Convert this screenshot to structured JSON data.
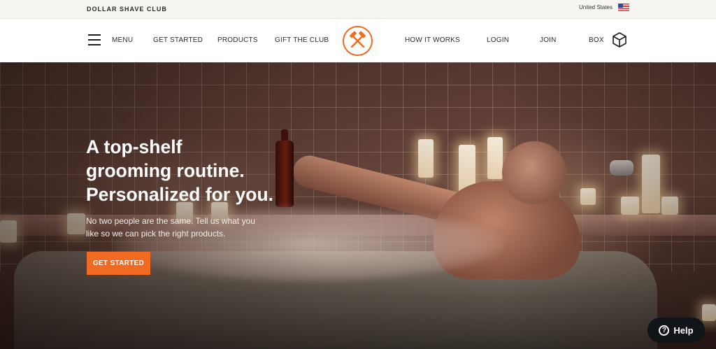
{
  "topbar": {
    "brand": "DOLLAR SHAVE CLUB",
    "region": "United States",
    "flag_icon": "us-flag-icon"
  },
  "nav": {
    "menu_label": "MENU",
    "menu_icon": "hamburger-icon",
    "left_items": [
      "GET STARTED",
      "PRODUCTS",
      "GIFT THE CLUB"
    ],
    "logo_icon": "crossed-hammers-logo",
    "right_items": [
      "HOW IT WORKS",
      "LOGIN",
      "JOIN",
      "BOX"
    ],
    "box_icon": "box-icon"
  },
  "hero": {
    "headline": [
      "A top-shelf",
      "grooming routine.",
      "Personalized for you."
    ],
    "subtext": "No two people are the same. Tell us what you like so we can pick the right products.",
    "cta_label": "GET STARTED"
  },
  "help": {
    "label": "Help",
    "icon_glyph": "?"
  },
  "colors": {
    "accent": "#f26a21",
    "help_bg": "#111418",
    "topbar_bg": "#f7f5f1"
  }
}
